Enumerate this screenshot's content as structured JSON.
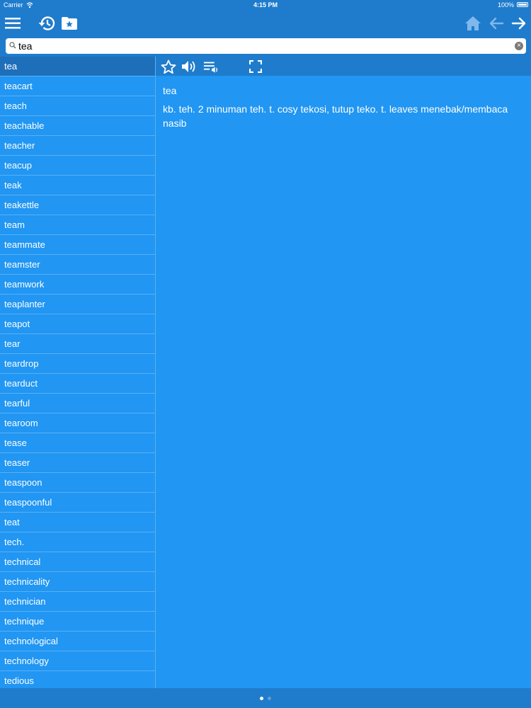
{
  "status": {
    "carrier": "Carrier",
    "time": "4:15 PM",
    "battery": "100%"
  },
  "toolbar": {
    "icons": [
      "menu-icon",
      "history-icon",
      "favorites-folder-icon",
      "home-icon",
      "back-arrow-icon",
      "forward-arrow-icon"
    ]
  },
  "search": {
    "value": "tea",
    "clear_label": "×"
  },
  "words": [
    "tea",
    "teacart",
    "teach",
    "teachable",
    "teacher",
    "teacup",
    "teak",
    "teakettle",
    "team",
    "teammate",
    "teamster",
    "teamwork",
    "teaplanter",
    "teapot",
    "tear",
    "teardrop",
    "tearduct",
    "tearful",
    "tearoom",
    "tease",
    "teaser",
    "teaspoon",
    "teaspoonful",
    "teat",
    "tech.",
    "technical",
    "technicality",
    "technician",
    "technique",
    "technological",
    "technology",
    "tedious"
  ],
  "selected_index": 0,
  "entry": {
    "headword": "tea",
    "definition": "kb. teh. 2 minuman teh. t. cosy tekosi, tutup teko. t. leaves menebak/membaca nasib"
  },
  "pager": {
    "count": 2,
    "current": 1
  },
  "colors": {
    "bar": "#1f7ccc",
    "panel": "#2196f3",
    "selected": "#1e6fba",
    "divider": "#5ab0f5"
  }
}
